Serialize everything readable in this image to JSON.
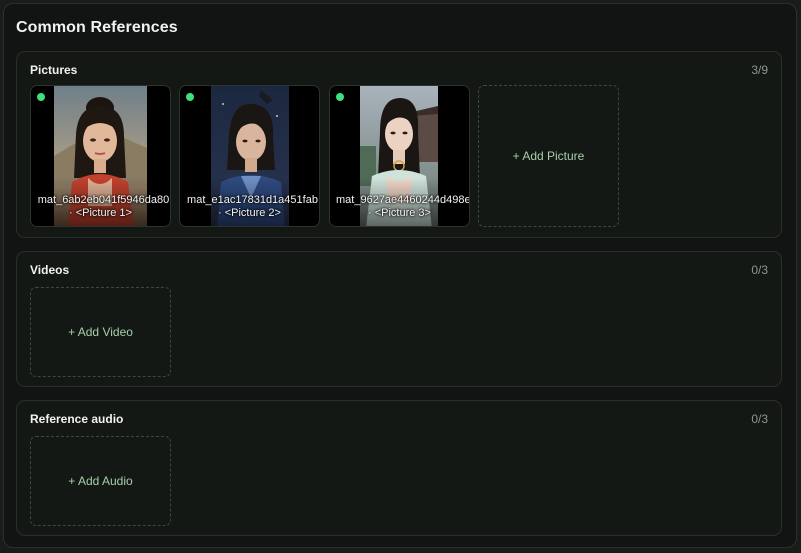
{
  "panel": {
    "title": "Common References"
  },
  "pictures": {
    "title": "Pictures",
    "count": "3/9",
    "items": [
      {
        "filename": "mat_6ab2eb041f5946da80",
        "label": "· <Picture 1>"
      },
      {
        "filename": "mat_e1ac17831d1a451fab",
        "label": "· <Picture 2>"
      },
      {
        "filename": "mat_9627ae4460244d498e",
        "label": "· <Picture 3>"
      }
    ],
    "add_label": "+ Add Picture"
  },
  "videos": {
    "title": "Videos",
    "count": "0/3",
    "add_label": "+ Add Video"
  },
  "audio": {
    "title": "Reference audio",
    "count": "0/3",
    "add_label": "+ Add Audio"
  },
  "colors": {
    "accent_dot": "#3ee07a",
    "add_text": "#a6cfa8"
  }
}
